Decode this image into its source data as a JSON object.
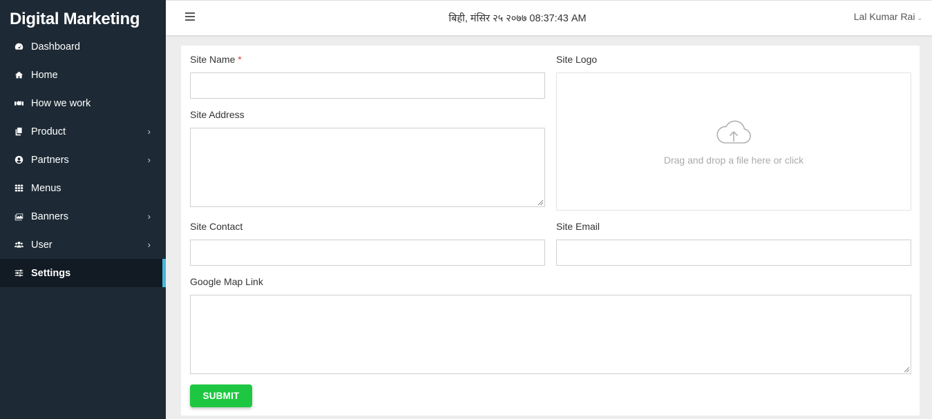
{
  "brand": "Digital Marketing",
  "nav": [
    {
      "label": "Dashboard",
      "icon": "dashboard-icon",
      "has_submenu": false
    },
    {
      "label": "Home",
      "icon": "home-icon",
      "has_submenu": false
    },
    {
      "label": "How we work",
      "icon": "handshake-icon",
      "has_submenu": false
    },
    {
      "label": "Product",
      "icon": "copy-icon",
      "has_submenu": true
    },
    {
      "label": "Partners",
      "icon": "user-circle-icon",
      "has_submenu": true
    },
    {
      "label": "Menus",
      "icon": "grid-icon",
      "has_submenu": false
    },
    {
      "label": "Banners",
      "icon": "images-icon",
      "has_submenu": true
    },
    {
      "label": "User",
      "icon": "users-icon",
      "has_submenu": true
    },
    {
      "label": "Settings",
      "icon": "sliders-icon",
      "has_submenu": false,
      "active": true
    }
  ],
  "topbar": {
    "datetime": "बिही, मंसिर २५ २०७७ 08:37:43 AM",
    "user_name": "Lal Kumar Rai"
  },
  "form": {
    "site_name_label": "Site Name",
    "required_mark": "*",
    "site_address_label": "Site Address",
    "site_logo_label": "Site Logo",
    "dropzone_text": "Drag and drop a file here or click",
    "site_contact_label": "Site Contact",
    "site_email_label": "Site Email",
    "google_map_label": "Google Map Link",
    "site_name_value": "",
    "site_address_value": "",
    "site_contact_value": "",
    "site_email_value": "",
    "google_map_value": "",
    "submit_label": "SUBMIT"
  },
  "colors": {
    "sidebar_bg": "#1d2a35",
    "active_indicator": "#46b8da",
    "submit_bg": "#1ec741",
    "required": "#e53935"
  }
}
